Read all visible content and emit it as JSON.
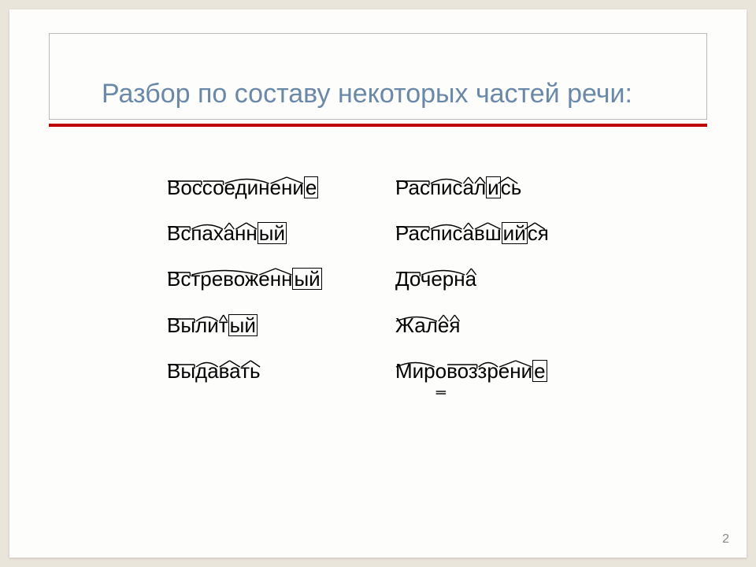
{
  "title": "Разбор по составу некоторых частей речи:",
  "page_number": "2",
  "rows": [
    {
      "left": "Воссоединение",
      "right": "Расписались"
    },
    {
      "left": "Вспаханный",
      "right": "Расписавшийся"
    },
    {
      "left": "Встревоженный",
      "right": "Дочерна"
    },
    {
      "left": "Вылитый",
      "right": "Жалея"
    },
    {
      "left": "Выдавать",
      "right": "Мировоззрение"
    }
  ],
  "morphemes": {
    "Воссоединение": [
      "prefix:Вос",
      "prefix:со",
      "root:един",
      "suffix:ени",
      "ending:е"
    ],
    "Расписались": [
      "prefix:Рас",
      "root:пис",
      "suffix:а",
      "suffix:л",
      "ending:и",
      "postfix:сь"
    ],
    "Вспаханный": [
      "prefix:Вс",
      "root:пах",
      "suffix:а",
      "suffix:нн",
      "ending:ый"
    ],
    "Расписавшийся": [
      "prefix:Рас",
      "root:пис",
      "suffix:а",
      "suffix:вш",
      "ending:ий",
      "postfix:ся"
    ],
    "Встревоженный": [
      "prefix:Вс",
      "root:тревож",
      "suffix:енн",
      "ending:ый"
    ],
    "Дочерна": [
      "prefix:До",
      "root:черн",
      "suffix:а"
    ],
    "Вылитый": [
      "prefix:Вы",
      "root:ли",
      "suffix:т",
      "ending:ый"
    ],
    "Жалея": [
      "root:Жал",
      "suffix:е",
      "suffix:я"
    ],
    "Выдавать": [
      "prefix:Вы",
      "root:да",
      "suffix:ва",
      "suffix:ть"
    ],
    "Мировоззрение": [
      "root:Мир",
      "link:о",
      "prefix:воз",
      "root:зр",
      "suffix:ени",
      "ending:е"
    ]
  }
}
